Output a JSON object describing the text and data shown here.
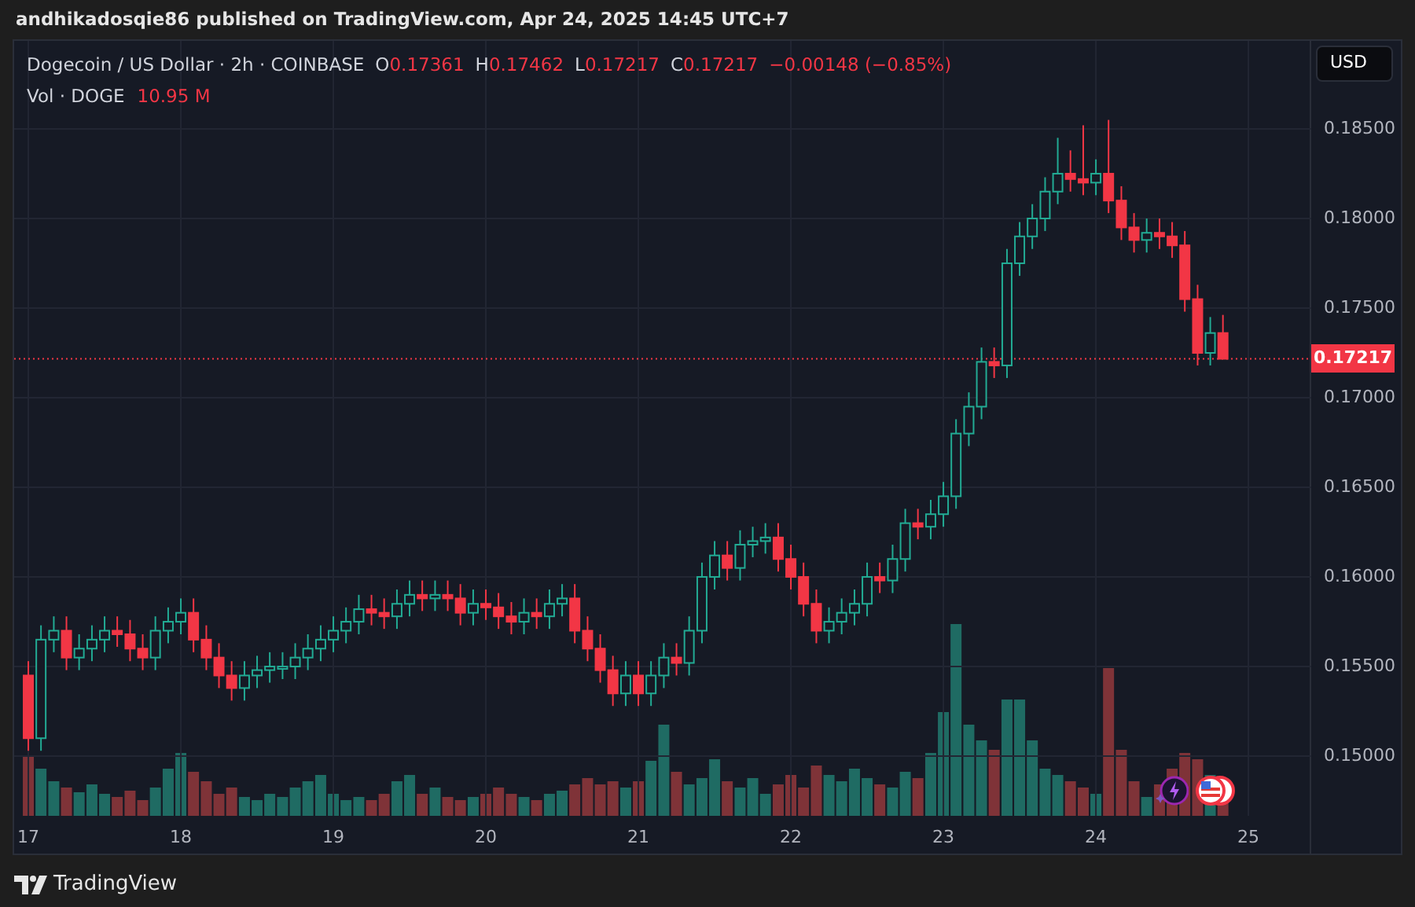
{
  "header": {
    "text": "andhikadosqie86 published on TradingView.com, Apr 24, 2025 14:45 UTC+7"
  },
  "legend": {
    "symbol": "Dogecoin / US Dollar · 2h · COINBASE",
    "ohlc": [
      {
        "label": "O",
        "value": "0.17361"
      },
      {
        "label": "H",
        "value": "0.17462"
      },
      {
        "label": "L",
        "value": "0.17217"
      },
      {
        "label": "C",
        "value": "0.17217"
      }
    ],
    "change": "−0.00148 (−0.85%)",
    "volume_label": "Vol · DOGE",
    "volume_value": "10.95 M"
  },
  "currency_button": "USD",
  "current_price": "0.17217",
  "chart_data": {
    "type": "candlestick",
    "xlim": [
      16.907,
      25.412
    ],
    "ylim": [
      0.14667,
      0.18991
    ],
    "grid": true,
    "ref_lines": [
      {
        "value": 0.17217,
        "axis": "y"
      }
    ],
    "x": [
      17,
      17.083,
      17.167,
      17.25,
      17.333,
      17.417,
      17.5,
      17.583,
      17.667,
      17.75,
      17.833,
      17.917,
      18,
      18.083,
      18.167,
      18.25,
      18.333,
      18.417,
      18.5,
      18.583,
      18.667,
      18.75,
      18.833,
      18.917,
      19,
      19.083,
      19.167,
      19.25,
      19.333,
      19.417,
      19.5,
      19.583,
      19.667,
      19.75,
      19.833,
      19.917,
      20,
      20.083,
      20.167,
      20.25,
      20.333,
      20.417,
      20.5,
      20.583,
      20.667,
      20.75,
      20.833,
      20.917,
      21,
      21.083,
      21.167,
      21.25,
      21.333,
      21.417,
      21.5,
      21.583,
      21.667,
      21.75,
      21.833,
      21.917,
      22,
      22.083,
      22.167,
      22.25,
      22.333,
      22.417,
      22.5,
      22.583,
      22.667,
      22.75,
      22.833,
      22.917,
      23,
      23.083,
      23.167,
      23.25,
      23.333,
      23.417,
      23.5,
      23.583,
      23.667,
      23.75,
      23.833,
      23.917,
      24,
      24.083,
      24.167,
      24.25,
      24.333,
      24.417,
      24.5,
      24.583,
      24.667,
      24.75,
      24.833
    ],
    "ohlc": [
      [
        0.1545,
        0.1553,
        0.1503,
        0.151
      ],
      [
        0.151,
        0.1573,
        0.1503,
        0.1565
      ],
      [
        0.1565,
        0.1578,
        0.1558,
        0.157
      ],
      [
        0.157,
        0.1578,
        0.1548,
        0.1555
      ],
      [
        0.1555,
        0.1568,
        0.1548,
        0.156
      ],
      [
        0.156,
        0.1573,
        0.1553,
        0.1565
      ],
      [
        0.1565,
        0.1578,
        0.1558,
        0.157
      ],
      [
        0.157,
        0.1578,
        0.1561,
        0.1568
      ],
      [
        0.1568,
        0.1576,
        0.1553,
        0.156
      ],
      [
        0.156,
        0.1568,
        0.1548,
        0.1555
      ],
      [
        0.1555,
        0.1578,
        0.1548,
        0.157
      ],
      [
        0.157,
        0.1583,
        0.1563,
        0.1575
      ],
      [
        0.1575,
        0.1588,
        0.1568,
        0.158
      ],
      [
        0.158,
        0.1588,
        0.1558,
        0.1565
      ],
      [
        0.1565,
        0.1573,
        0.1548,
        0.1555
      ],
      [
        0.1555,
        0.1563,
        0.1538,
        0.1545
      ],
      [
        0.1545,
        0.1553,
        0.1531,
        0.1538
      ],
      [
        0.1538,
        0.1553,
        0.1531,
        0.1545
      ],
      [
        0.1545,
        0.1556,
        0.1538,
        0.1548
      ],
      [
        0.1548,
        0.1558,
        0.1541,
        0.155
      ],
      [
        0.155,
        0.1558,
        0.1543,
        0.155
      ],
      [
        0.155,
        0.1563,
        0.1543,
        0.1555
      ],
      [
        0.1555,
        0.1568,
        0.1548,
        0.156
      ],
      [
        0.156,
        0.1573,
        0.1553,
        0.1565
      ],
      [
        0.1565,
        0.1578,
        0.1558,
        0.157
      ],
      [
        0.157,
        0.1583,
        0.1563,
        0.1575
      ],
      [
        0.1575,
        0.159,
        0.1568,
        0.1582
      ],
      [
        0.1582,
        0.159,
        0.1573,
        0.158
      ],
      [
        0.158,
        0.1588,
        0.1571,
        0.1578
      ],
      [
        0.1578,
        0.1593,
        0.1571,
        0.1585
      ],
      [
        0.1585,
        0.1598,
        0.1578,
        0.159
      ],
      [
        0.159,
        0.1598,
        0.1581,
        0.1588
      ],
      [
        0.1588,
        0.1598,
        0.1581,
        0.159
      ],
      [
        0.159,
        0.1598,
        0.1581,
        0.1588
      ],
      [
        0.1588,
        0.1596,
        0.1573,
        0.158
      ],
      [
        0.158,
        0.1593,
        0.1573,
        0.1585
      ],
      [
        0.1585,
        0.1593,
        0.1576,
        0.1583
      ],
      [
        0.1583,
        0.1591,
        0.1571,
        0.1578
      ],
      [
        0.1578,
        0.1586,
        0.1568,
        0.1575
      ],
      [
        0.1575,
        0.1588,
        0.1568,
        0.158
      ],
      [
        0.158,
        0.1588,
        0.1571,
        0.1578
      ],
      [
        0.1578,
        0.1593,
        0.1571,
        0.1585
      ],
      [
        0.1585,
        0.1596,
        0.1578,
        0.1588
      ],
      [
        0.1588,
        0.1596,
        0.1563,
        0.157
      ],
      [
        0.157,
        0.1578,
        0.1553,
        0.156
      ],
      [
        0.156,
        0.1568,
        0.1541,
        0.1548
      ],
      [
        0.1548,
        0.1556,
        0.1528,
        0.1535
      ],
      [
        0.1535,
        0.1553,
        0.1528,
        0.1545
      ],
      [
        0.1545,
        0.1553,
        0.1528,
        0.1535
      ],
      [
        0.1535,
        0.1553,
        0.1528,
        0.1545
      ],
      [
        0.1545,
        0.1563,
        0.1538,
        0.1555
      ],
      [
        0.1555,
        0.1563,
        0.1545,
        0.1552
      ],
      [
        0.1552,
        0.1578,
        0.1545,
        0.157
      ],
      [
        0.157,
        0.1608,
        0.1563,
        0.16
      ],
      [
        0.16,
        0.162,
        0.1593,
        0.1612
      ],
      [
        0.1612,
        0.162,
        0.1598,
        0.1605
      ],
      [
        0.1605,
        0.1626,
        0.1598,
        0.1618
      ],
      [
        0.1618,
        0.1628,
        0.1611,
        0.162
      ],
      [
        0.162,
        0.163,
        0.1613,
        0.1622
      ],
      [
        0.1622,
        0.163,
        0.1603,
        0.161
      ],
      [
        0.161,
        0.1618,
        0.1593,
        0.16
      ],
      [
        0.16,
        0.1608,
        0.1578,
        0.1585
      ],
      [
        0.1585,
        0.1593,
        0.1563,
        0.157
      ],
      [
        0.157,
        0.1583,
        0.1563,
        0.1575
      ],
      [
        0.1575,
        0.1588,
        0.1568,
        0.158
      ],
      [
        0.158,
        0.1593,
        0.1573,
        0.1585
      ],
      [
        0.1585,
        0.1608,
        0.1578,
        0.16
      ],
      [
        0.16,
        0.1608,
        0.1591,
        0.1598
      ],
      [
        0.1598,
        0.1618,
        0.1591,
        0.161
      ],
      [
        0.161,
        0.1638,
        0.1603,
        0.163
      ],
      [
        0.163,
        0.1638,
        0.1621,
        0.1628
      ],
      [
        0.1628,
        0.1643,
        0.1621,
        0.1635
      ],
      [
        0.1635,
        0.1653,
        0.1628,
        0.1645
      ],
      [
        0.1645,
        0.1688,
        0.1638,
        0.168
      ],
      [
        0.168,
        0.1703,
        0.1673,
        0.1695
      ],
      [
        0.1695,
        0.1728,
        0.1688,
        0.172
      ],
      [
        0.172,
        0.1728,
        0.1711,
        0.1718
      ],
      [
        0.1718,
        0.1783,
        0.1711,
        0.1775
      ],
      [
        0.1775,
        0.1798,
        0.1768,
        0.179
      ],
      [
        0.179,
        0.1808,
        0.1783,
        0.18
      ],
      [
        0.18,
        0.1823,
        0.1793,
        0.1815
      ],
      [
        0.1815,
        0.1845,
        0.1808,
        0.1825
      ],
      [
        0.1825,
        0.1838,
        0.1815,
        0.1822
      ],
      [
        0.1822,
        0.1852,
        0.1813,
        0.182
      ],
      [
        0.182,
        0.1833,
        0.1813,
        0.1825
      ],
      [
        0.1825,
        0.1855,
        0.1803,
        0.181
      ],
      [
        0.181,
        0.1818,
        0.1788,
        0.1795
      ],
      [
        0.1795,
        0.1803,
        0.1781,
        0.1788
      ],
      [
        0.1788,
        0.18,
        0.1781,
        0.1792
      ],
      [
        0.1792,
        0.18,
        0.1783,
        0.179
      ],
      [
        0.179,
        0.1798,
        0.1778,
        0.1785
      ],
      [
        0.1785,
        0.1793,
        0.1748,
        0.1755
      ],
      [
        0.1755,
        0.1763,
        0.1718,
        0.1725
      ],
      [
        0.1725,
        0.1745,
        0.1718,
        0.17361
      ],
      [
        0.17361,
        0.17462,
        0.17217,
        0.17217
      ]
    ],
    "yticks": [
      {
        "value": 0.185,
        "label": "0.18500"
      },
      {
        "value": 0.18,
        "label": "0.18000"
      },
      {
        "value": 0.175,
        "label": "0.17500"
      },
      {
        "value": 0.17,
        "label": "0.17000"
      },
      {
        "value": 0.165,
        "label": "0.16500"
      },
      {
        "value": 0.16,
        "label": "0.16000"
      },
      {
        "value": 0.155,
        "label": "0.15500"
      },
      {
        "value": 0.15,
        "label": "0.15000"
      }
    ],
    "xticks": [
      {
        "value": 17,
        "label": "17"
      },
      {
        "value": 18,
        "label": "18"
      },
      {
        "value": 19,
        "label": "19"
      },
      {
        "value": 20,
        "label": "20"
      },
      {
        "value": 21,
        "label": "21"
      },
      {
        "value": 22,
        "label": "22"
      },
      {
        "value": 23,
        "label": "23"
      },
      {
        "value": 24,
        "label": "24"
      },
      {
        "value": 25,
        "label": "25"
      }
    ]
  },
  "footer": {
    "brand": "TradingView"
  }
}
